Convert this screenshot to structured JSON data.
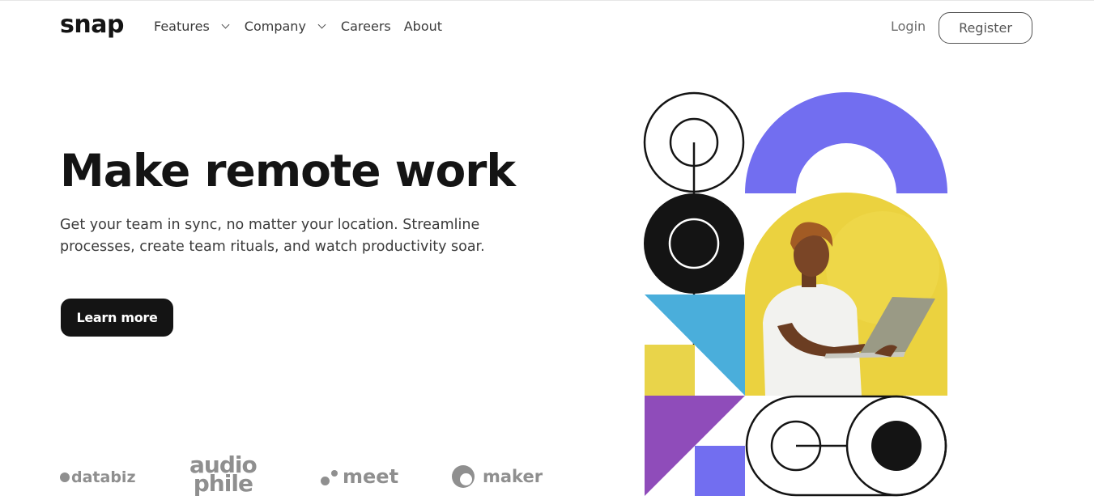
{
  "header": {
    "logo": "snap",
    "nav": [
      {
        "label": "Features",
        "dropdown": true
      },
      {
        "label": "Company",
        "dropdown": true
      },
      {
        "label": "Careers",
        "dropdown": false
      },
      {
        "label": "About",
        "dropdown": false
      }
    ],
    "login_label": "Login",
    "register_label": "Register"
  },
  "hero": {
    "title": "Make remote work",
    "description": "Get your team in sync, no matter your location. Streamline processes, create team rituals, and watch productivity soar.",
    "cta_label": "Learn more"
  },
  "clients": {
    "databiz": "databiz",
    "audiophile_line1": "audio",
    "audiophile_line2": "phile",
    "meet": "meet",
    "maker": "maker"
  },
  "colors": {
    "dark": "#141414",
    "purple": "#726ef0",
    "yellow": "#e9cf38",
    "blue": "#4aaedb",
    "violet": "#8f4cba",
    "gray_logo": "#8f8f8f"
  },
  "icons": {
    "nav_dropdown": "chevron-down-icon",
    "hero_image": "person-with-laptop-illustration"
  }
}
